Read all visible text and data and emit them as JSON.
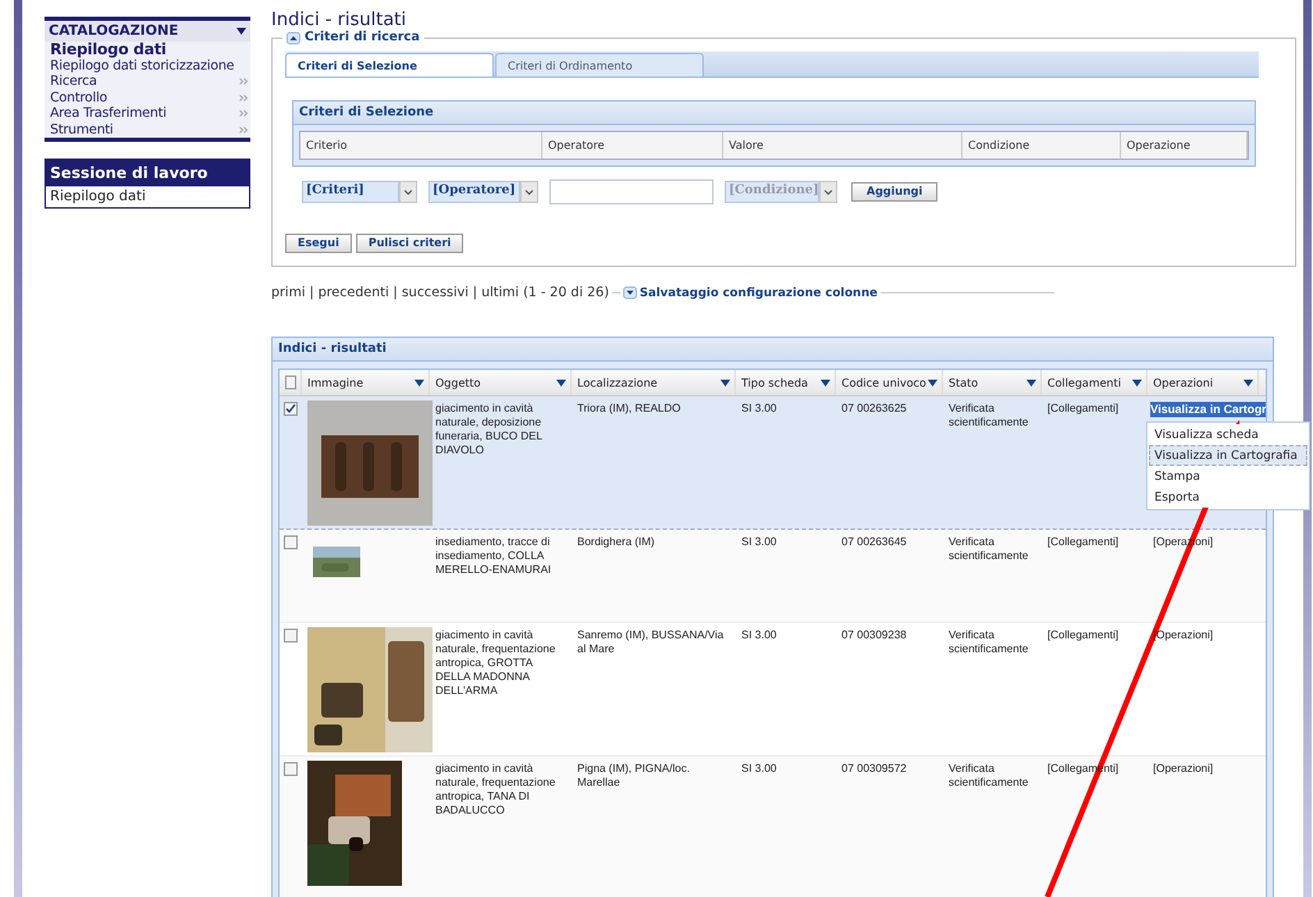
{
  "sidebar": {
    "menu": {
      "title": "CATALOGAZIONE",
      "items": [
        {
          "label": "Riepilogo dati",
          "selected": true,
          "expandable": false
        },
        {
          "label": "Riepilogo dati storicizzazione",
          "selected": false,
          "expandable": false
        },
        {
          "label": "Ricerca",
          "selected": false,
          "expandable": true
        },
        {
          "label": "Controllo",
          "selected": false,
          "expandable": true
        },
        {
          "label": "Area Trasferimenti",
          "selected": false,
          "expandable": true
        },
        {
          "label": "Strumenti",
          "selected": false,
          "expandable": true
        }
      ]
    },
    "session": {
      "title": "Sessione di lavoro",
      "items": [
        "Riepilogo dati"
      ]
    }
  },
  "page_title": "Indici - risultati",
  "search_panel": {
    "legend": "Criteri di ricerca",
    "tabs": [
      {
        "label": "Criteri di Selezione",
        "selected": true
      },
      {
        "label": "Criteri di Ordinamento",
        "selected": false
      }
    ],
    "criteria_grid": {
      "title": "Criteri di Selezione",
      "columns": [
        "Criterio",
        "Operatore",
        "Valore",
        "Condizione",
        "Operazione"
      ]
    },
    "controls": [
      {
        "kind": "select",
        "value": "[Criteri]",
        "disabled": false
      },
      {
        "kind": "select",
        "value": "[Operatore]",
        "disabled": false
      },
      {
        "kind": "input"
      },
      {
        "kind": "select",
        "value": "[Condizione]",
        "disabled": true
      },
      {
        "kind": "button",
        "label": "Aggiungi"
      }
    ],
    "buttons": [
      "Esegui",
      "Pulisci criteri"
    ]
  },
  "pager": {
    "text": "primi | precedenti | successivi | ultimi (1 - 20 di 26)",
    "column_config": "Salvataggio configurazione colonne"
  },
  "results": {
    "title": "Indici - risultati",
    "header_checked": false,
    "columns": [
      "Immagine",
      "Oggetto",
      "Localizzazione",
      "Tipo scheda",
      "Codice univoco",
      "Stato",
      "Collegamenti",
      "Operazioni"
    ],
    "rows": [
      {
        "checked": true,
        "selected": true,
        "oggetto": "giacimento in cavità naturale, deposizione funeraria, BUCO DEL DIAVOLO",
        "localizzazione": "Triora (IM), REALDO",
        "tipo": "SI 3.00",
        "codice": "07 00263625",
        "stato": "Verificata scientificamente",
        "collegamenti": "[Collegamenti]",
        "operazioni": "Visualizza in Cartogr",
        "operazioni_open": true
      },
      {
        "checked": false,
        "selected": false,
        "oggetto": "insediamento, tracce di insediamento, COLLA MERELLO-ENAMURAI",
        "localizzazione": "Bordighera (IM)",
        "tipo": "SI 3.00",
        "codice": "07 00263645",
        "stato": "Verificata scientificamente",
        "collegamenti": "[Collegamenti]",
        "operazioni": "[Operazioni]",
        "operazioni_open": false
      },
      {
        "checked": false,
        "selected": false,
        "oggetto": "giacimento in cavità naturale, frequentazione antropica, GROTTA DELLA MADONNA DELL'ARMA",
        "localizzazione": "Sanremo (IM), BUSSANA/Via al Mare",
        "tipo": "SI 3.00",
        "codice": "07 00309238",
        "stato": "Verificata scientificamente",
        "collegamenti": "[Collegamenti]",
        "operazioni": "[Operazioni]",
        "operazioni_open": false
      },
      {
        "checked": false,
        "selected": false,
        "oggetto": "giacimento in cavità naturale, frequentazione antropica, TANA DI BADALUCCO",
        "localizzazione": "Pigna (IM), PIGNA/loc. Marellae",
        "tipo": "SI 3.00",
        "codice": "07 00309572",
        "stato": "Verificata scientificamente",
        "collegamenti": "[Collegamenti]",
        "operazioni": "[Operazioni]",
        "operazioni_open": false
      }
    ],
    "operations_menu": [
      {
        "label": "Visualizza scheda",
        "selected": false
      },
      {
        "label": "Visualizza in Cartografia",
        "selected": true
      },
      {
        "label": "Stampa",
        "selected": false
      },
      {
        "label": "Esporta",
        "selected": false
      }
    ]
  },
  "annotation": {
    "kind": "arrow"
  }
}
